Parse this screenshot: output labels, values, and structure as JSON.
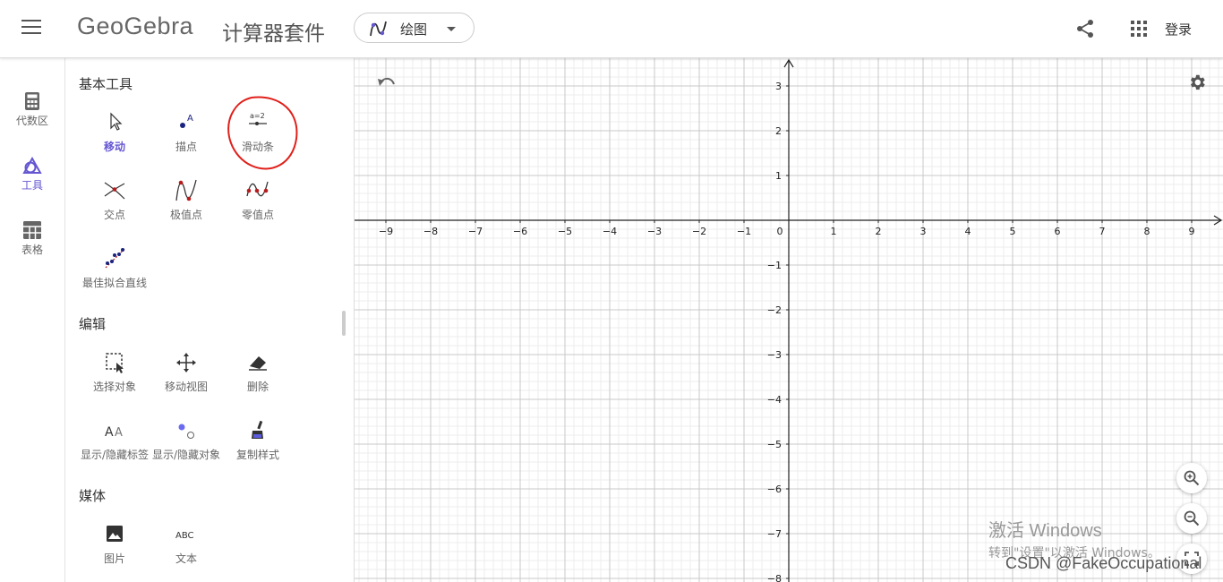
{
  "header": {
    "brand": "GeoGebra",
    "suite_title": "计算器套件",
    "app_selector": {
      "label": "绘图",
      "icon": "graphing-icon"
    },
    "login": "登录",
    "share_icon": "share-icon",
    "apps_icon": "apps-grid-icon"
  },
  "rail": [
    {
      "label": "代数区",
      "icon": "calculator-icon"
    },
    {
      "label": "工具",
      "icon": "tools-icon",
      "active": true
    },
    {
      "label": "表格",
      "icon": "table-icon"
    }
  ],
  "tools": {
    "sections": [
      "基本工具",
      "编辑",
      "媒体"
    ],
    "basic": [
      "移动",
      "描点",
      "滑动条",
      "交点",
      "极值点",
      "零值点",
      "最佳拟合直线"
    ],
    "edit": [
      "选择对象",
      "移动视图",
      "删除",
      "显示/隐藏标签",
      "显示/隐藏对象",
      "复制样式"
    ],
    "media": [
      "图片",
      "文本"
    ],
    "slider_icon_text": "a=2",
    "text_icon_text": "ABC",
    "selected": "移动",
    "annotation_color": "#e0201b"
  },
  "graph": {
    "x_ticks": [
      "−9",
      "−8",
      "−7",
      "−6",
      "−5",
      "−4",
      "−3",
      "−2",
      "−1",
      "0",
      "1",
      "2",
      "3",
      "4",
      "5",
      "6",
      "7",
      "8",
      "9"
    ],
    "y_ticks": [
      "3",
      "2",
      "1",
      "−1",
      "−2",
      "−3",
      "−4",
      "−5",
      "−6",
      "−7",
      "−8"
    ],
    "x_range": [
      -9.7,
      9.7
    ],
    "y_range": [
      -8,
      3.6
    ]
  },
  "watermark": {
    "line1": "激活 Windows",
    "line2": "转到\"设置\"以激活 Windows。"
  },
  "credit": "CSDN @FakeOccupational",
  "colors": {
    "accent": "#6557d2",
    "grid_major": "#c8c8c8",
    "grid_minor": "#ececec"
  }
}
